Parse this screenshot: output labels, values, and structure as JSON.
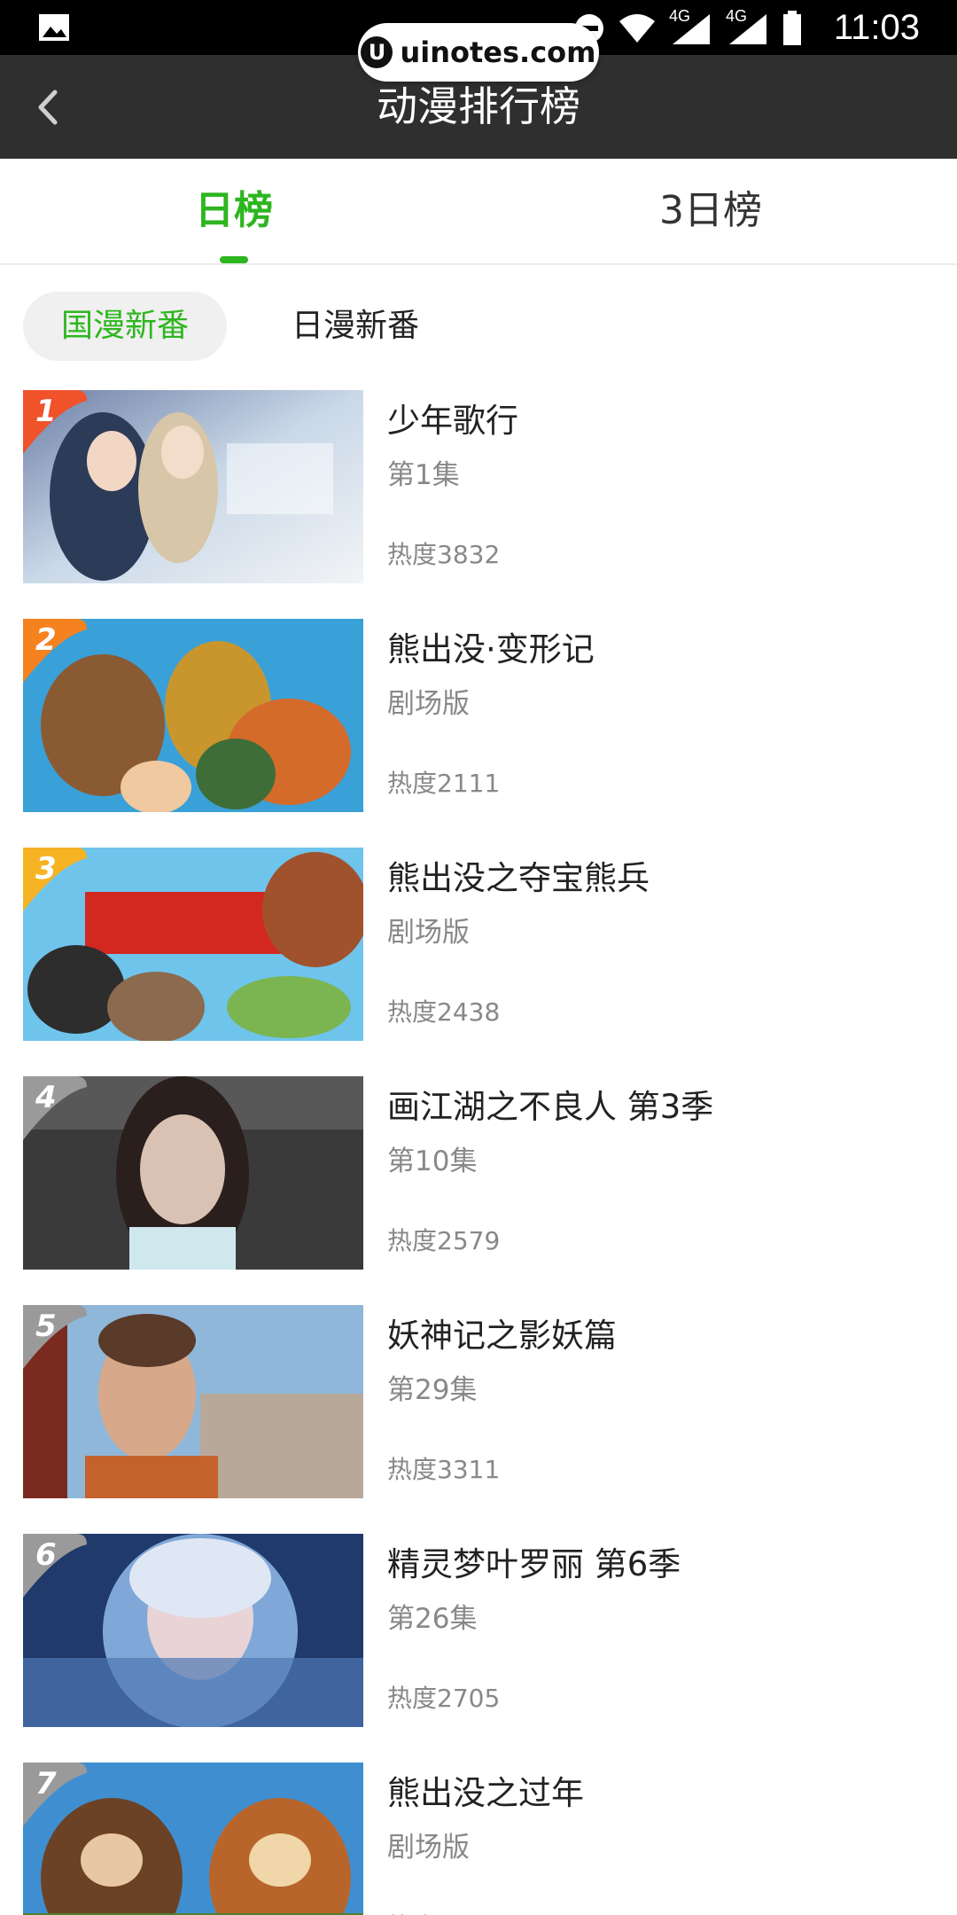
{
  "status_bar": {
    "time": "11:03",
    "network_1": "4G",
    "network_2": "4G",
    "watermark": "uinotes.com",
    "watermark_logo": "U"
  },
  "header": {
    "title": "动漫排行榜",
    "back_icon": "chevron-left-icon"
  },
  "tabs": [
    {
      "label": "日榜",
      "active": true
    },
    {
      "label": "3日榜",
      "active": false
    }
  ],
  "filters": [
    {
      "label": "国漫新番",
      "active": true
    },
    {
      "label": "日漫新番",
      "active": false
    }
  ],
  "colors": {
    "accent": "#2db61f",
    "rank_1": "#f0522a",
    "rank_2": "#f5821f",
    "rank_3": "#f6b324",
    "rank_other": "#9a9a9a"
  },
  "items": [
    {
      "rank": "1",
      "title": "少年歌行",
      "subtitle": "第1集",
      "heat": "热度3832"
    },
    {
      "rank": "2",
      "title": "熊出没·变形记",
      "subtitle": "剧场版",
      "heat": "热度2111"
    },
    {
      "rank": "3",
      "title": "熊出没之夺宝熊兵",
      "subtitle": "剧场版",
      "heat": "热度2438"
    },
    {
      "rank": "4",
      "title": "画江湖之不良人 第3季",
      "subtitle": "第10集",
      "heat": "热度2579"
    },
    {
      "rank": "5",
      "title": "妖神记之影妖篇",
      "subtitle": "第29集",
      "heat": "热度3311"
    },
    {
      "rank": "6",
      "title": "精灵梦叶罗丽 第6季",
      "subtitle": "第26集",
      "heat": "热度2705"
    },
    {
      "rank": "7",
      "title": "熊出没之过年",
      "subtitle": "剧场版",
      "heat": "热度"
    }
  ]
}
